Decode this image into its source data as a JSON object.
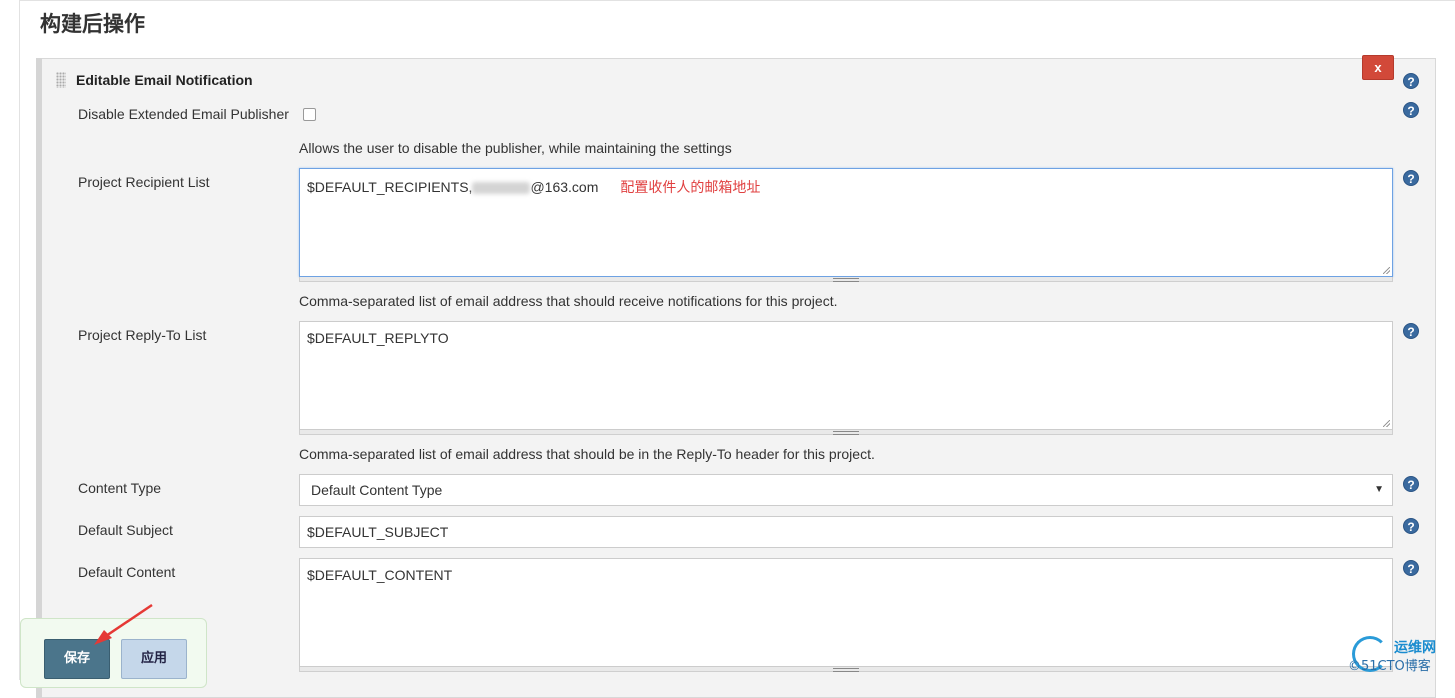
{
  "section": {
    "title": "构建后操作"
  },
  "panel": {
    "title": "Editable Email Notification",
    "delete_label": "x",
    "help_glyph": "?"
  },
  "disable_publisher": {
    "label": "Disable Extended Email Publisher",
    "checked": false,
    "description": "Allows the user to disable the publisher, while maintaining the settings"
  },
  "recipient_list": {
    "label": "Project Recipient List",
    "value_prefix": "$DEFAULT_RECIPIENTS,",
    "value_suffix": "@163.com",
    "annotation": "配置收件人的邮箱地址",
    "description": "Comma-separated list of email address that should receive notifications for this project."
  },
  "reply_to": {
    "label": "Project Reply-To List",
    "value": "$DEFAULT_REPLYTO",
    "description": "Comma-separated list of email address that should be in the Reply-To header for this project."
  },
  "content_type": {
    "label": "Content Type",
    "selected": "Default Content Type"
  },
  "default_subject": {
    "label": "Default Subject",
    "value": "$DEFAULT_SUBJECT"
  },
  "default_content": {
    "label": "Default Content",
    "value": "$DEFAULT_CONTENT"
  },
  "buttons": {
    "save": "保存",
    "apply": "应用"
  },
  "watermark": {
    "line1": "运维网",
    "line2": "©51CTO博客"
  },
  "colors": {
    "delete": "#d24939",
    "save": "#4b758b",
    "apply": "#c5d7ea",
    "annotation": "#e04040",
    "help": "#3a6a9f"
  }
}
